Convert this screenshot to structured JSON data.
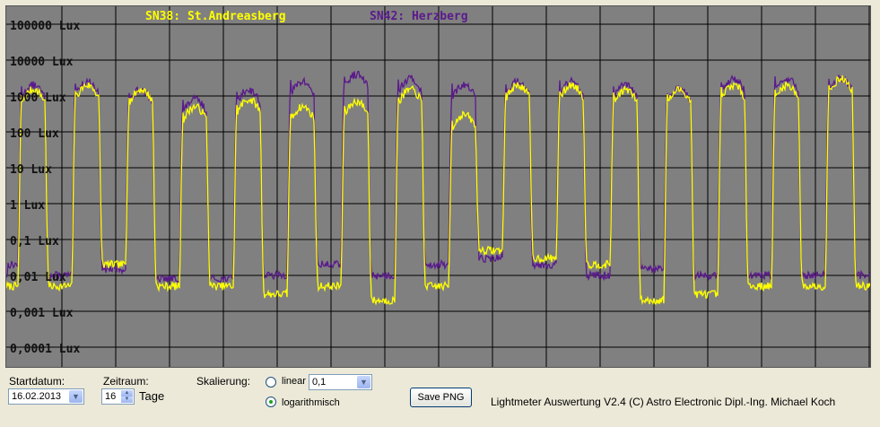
{
  "chart_data": {
    "type": "line",
    "y_scale": "log",
    "ylim": [
      0.0001,
      100000
    ],
    "y_tick_labels": [
      "100000 Lux",
      "10000 Lux",
      "1000 Lux",
      "100 Lux",
      "10 Lux",
      "1 Lux",
      "0,1 Lux",
      "0,01 Lux",
      "0,001 Lux",
      "0,0001 Lux"
    ],
    "x_start": "16.02.2013",
    "x_days": 16,
    "grid": true,
    "legend_position": "top",
    "series": [
      {
        "name": "SN38: St.Andreasberg",
        "color": "#ffff00",
        "day_peak": [
          1500,
          2000,
          1500,
          500,
          800,
          500,
          700,
          1500,
          300,
          2000,
          2000,
          1500,
          1500,
          2000,
          2000,
          3000
        ],
        "night_level": [
          0.005,
          0.005,
          0.02,
          0.005,
          0.005,
          0.003,
          0.005,
          0.002,
          0.005,
          0.05,
          0.03,
          0.02,
          0.002,
          0.003,
          0.005,
          0.005
        ]
      },
      {
        "name": "SN42: Herzberg",
        "color": "#5a1a8c",
        "day_peak": [
          2000,
          2500,
          1500,
          800,
          1500,
          2500,
          4000,
          3000,
          2000,
          2500,
          2500,
          2000,
          1500,
          3000,
          3000,
          3000
        ],
        "night_level": [
          0.02,
          0.01,
          0.015,
          0.008,
          0.008,
          0.01,
          0.02,
          0.01,
          0.02,
          0.03,
          0.02,
          0.01,
          0.015,
          0.01,
          0.01,
          0.01
        ]
      }
    ]
  },
  "controls": {
    "startdatum_label": "Startdatum:",
    "startdatum_value": "16.02.2013",
    "zeitraum_label": "Zeitraum:",
    "zeitraum_value": "16",
    "tage_label": "Tage",
    "skalierung_label": "Skalierung:",
    "linear_label": "linear",
    "linear_value": "0,1",
    "log_label": "logarithmisch",
    "scale_selected": "logarithmisch",
    "save_label": "Save PNG",
    "footer": "Lightmeter Auswertung V2.4  (C) Astro Electronic Dipl.-Ing. Michael Koch"
  }
}
